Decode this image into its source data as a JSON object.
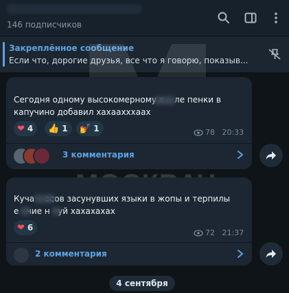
{
  "header": {
    "subscribers": "146 подписчиков",
    "icons": [
      "search-icon",
      "sidebar-toggle-icon",
      "more-icon"
    ]
  },
  "pinned": {
    "title": "Закреплённое сообщение",
    "text": "Если что, дорогие друзья, все что я говорю, показыв...",
    "icon": "unpin-icon"
  },
  "messages": [
    {
      "text_line1": "Сегодня одному высокомерному х    ле пенки в",
      "text_line2": "капучино добавил хахаахххаах",
      "reactions": [
        {
          "emoji": "❤",
          "count": "4"
        },
        {
          "emoji": "👍",
          "count": "1"
        },
        {
          "emoji": "💅",
          "count": "1"
        }
      ],
      "views": "78",
      "time": "20:33",
      "comments_label": "3 комментария"
    },
    {
      "text_line1": "Куча    осов засунувших языки в жопы и терпилы",
      "text_line2": "е   чие н   уй хахахахах",
      "reactions": [
        {
          "emoji": "❤",
          "count": "6"
        }
      ],
      "views": "72",
      "time": "21:37",
      "comments_label": "2 комментария"
    }
  ],
  "date_separator": "4 сентября",
  "watermark": "МОСКВАЧ",
  "colors": {
    "accent": "#5ea2e0",
    "background": "#0f1419",
    "bubble": "#1c2733",
    "header": "#17212b"
  }
}
